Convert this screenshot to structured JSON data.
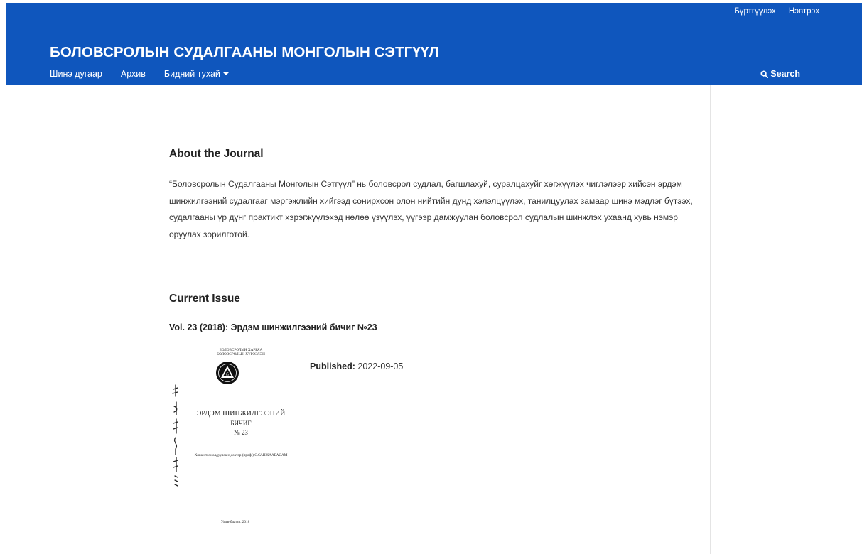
{
  "header": {
    "user_nav": {
      "register": "Бүртгүүлэх",
      "login": "Нэвтрэх"
    },
    "site_title": "БОЛОВСРОЛЫН СУДАЛГААНЫ МОНГОЛЫН СЭТГҮҮЛ",
    "nav": {
      "current": "Шинэ дугаар",
      "archive": "Архив",
      "about": "Бидний тухай"
    },
    "search_label": "Search",
    "bg_color": "#0f56bd"
  },
  "about": {
    "heading": "About the Journal",
    "text": "“Боловсролын Судалгааны Монголын Сэтгүүл” нь боловсрол судлал, багшлахуй, суралцахуйг хөгжүүлэх чиглэлээр хийсэн эрдэм шинжилгээний судалгааг мэргэжлийн хийгээд сонирхсон олон нийтийн дунд хэлэлцүүлэх, танилцуулах замаар шинэ мэдлэг бүтээх, судалгааны үр дүнг практикт хэрэгжүүлэхэд нөлөө үзүүлэх, үүгээр дамжуулан боловсрол судлалын шинжлэх ухаанд хувь нэмэр оруулах зорилготой."
  },
  "current_issue": {
    "heading": "Current Issue",
    "title": "Vol. 23 (2018): Эрдэм шинжилгээний бичиг №23",
    "published_label": "Published:",
    "published_date": "2022-09-05",
    "cover": {
      "institution_line1": "БОЛОВСРОЛЫН ХАРЬЯА",
      "institution_line2": "БОЛОВСРОЛЫН ХҮРЭЭЛЭН",
      "title_line1": "ЭРДЭМ ШИНЖИЛГЭЭНИЙ",
      "title_line2": "БИЧИГ",
      "number": "№ 23",
      "editor": "Хянан тохиолдуулсан: доктор (проф.) С.САНЖААБАДАМ",
      "city_year": "Улаанбаатар, 2018"
    }
  }
}
